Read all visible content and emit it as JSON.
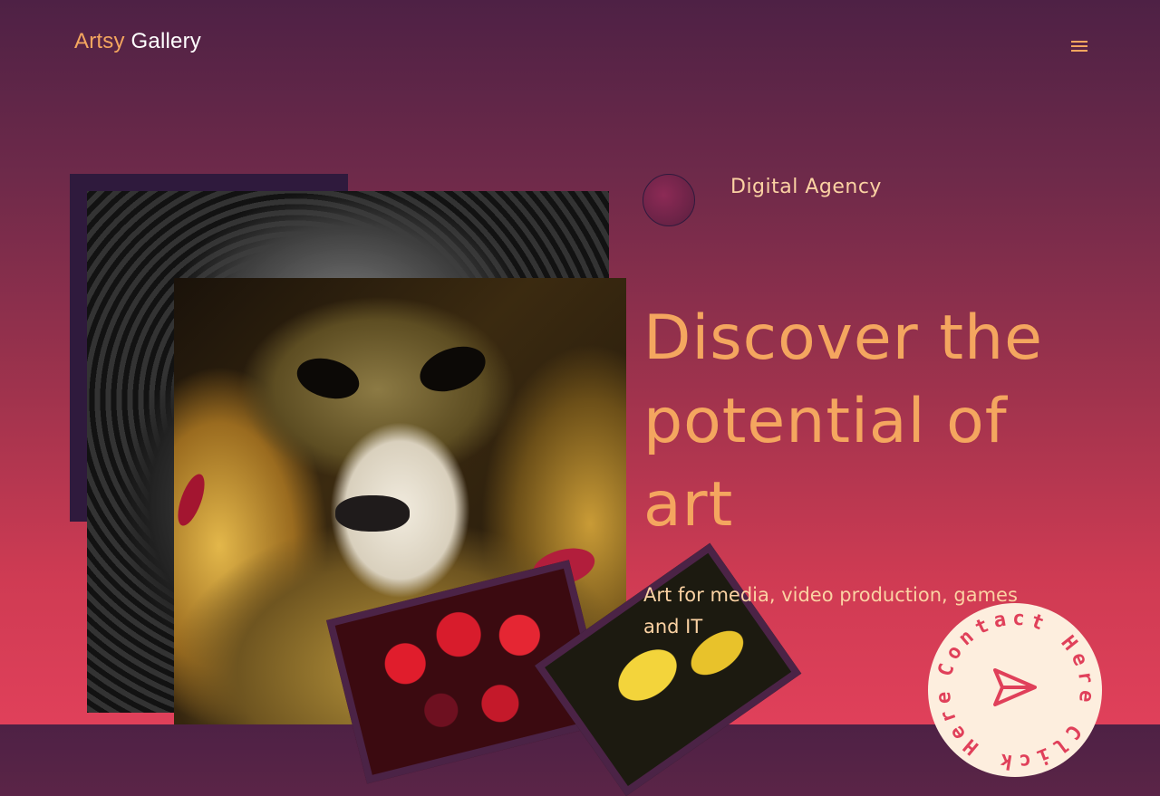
{
  "header": {
    "logo_part1": "Artsy",
    "logo_part2": "Gallery",
    "menu_icon": "hamburger-icon"
  },
  "hero": {
    "tag": "Digital Agency",
    "headline_line1": "Discover the",
    "headline_line2": "potential of",
    "headline_line3": "art",
    "subtext": "Art for media, video production, games and IT"
  },
  "contact_button": {
    "ring_text": "Contact Here Click Here Contact",
    "icon": "send-icon"
  },
  "colors": {
    "accent": "#f4a65f",
    "text_light": "#fbd2a3",
    "contact_bg": "#fdeede",
    "contact_fg": "#e0405a"
  }
}
